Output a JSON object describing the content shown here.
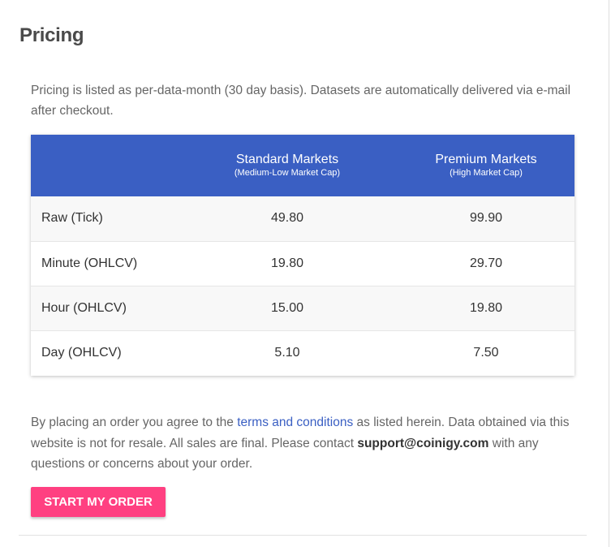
{
  "title": "Pricing",
  "intro": "Pricing is listed as per-data-month (30 day basis). Datasets are automatically delivered via e-mail after checkout.",
  "table": {
    "headers": [
      {
        "main": "",
        "sub": ""
      },
      {
        "main": "Standard Markets",
        "sub": "(Medium-Low Market Cap)"
      },
      {
        "main": "Premium Markets",
        "sub": "(High Market Cap)"
      }
    ],
    "rows": [
      {
        "label": "Raw (Tick)",
        "standard": "49.80",
        "premium": "99.90"
      },
      {
        "label": "Minute (OHLCV)",
        "standard": "19.80",
        "premium": "29.70"
      },
      {
        "label": "Hour (OHLCV)",
        "standard": "15.00",
        "premium": "19.80"
      },
      {
        "label": "Day (OHLCV)",
        "standard": "5.10",
        "premium": "7.50"
      }
    ]
  },
  "footer": {
    "prefix": "By placing an order you agree to the ",
    "terms_link": "terms and conditions",
    "middle": " as listed herein. Data obtained via this website is not for resale. All sales are final. Please contact ",
    "email": "support@coinigy.com",
    "suffix": " with any questions or concerns about your order."
  },
  "order_button": "START MY ORDER",
  "colors": {
    "header_bg": "#3a5fc3",
    "button_bg": "#ff4081",
    "link": "#3a5fc3"
  }
}
